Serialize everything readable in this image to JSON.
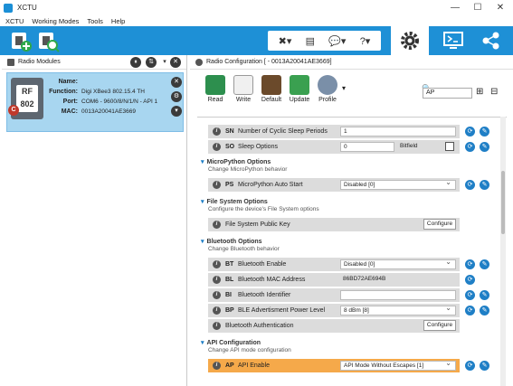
{
  "window": {
    "title": "XCTU",
    "minimize": "—",
    "maximize": "☐",
    "close": "✕"
  },
  "menu": [
    "XCTU",
    "Working Modes",
    "Tools",
    "Help"
  ],
  "toolbar": {
    "mid_icons": [
      "✖▾",
      "▤",
      "💬▾",
      "?▾"
    ],
    "gear_icon": "gear-icon",
    "right_icons": [
      "console-icon",
      "network-icon"
    ]
  },
  "left_pane": {
    "title": "Radio Modules",
    "radio": {
      "chip_text": "RF\n802",
      "badge": "C",
      "fields": [
        {
          "k": "Name:",
          "v": ""
        },
        {
          "k": "Function:",
          "v": "Digi XBee3 802.15.4 TH"
        },
        {
          "k": "Port:",
          "v": "COM6 - 9600/8/N/1/N - API 1"
        },
        {
          "k": "MAC:",
          "v": "0013A20041AE3669"
        }
      ]
    }
  },
  "right_pane": {
    "title": "Radio Configuration [ - 0013A20041AE3669]",
    "ribbon": [
      "Read",
      "Write",
      "Default",
      "Update",
      "Profile"
    ],
    "search": "AP",
    "rows": [
      {
        "code": "SN",
        "name": "Number of Cyclic Sleep Periods",
        "value": "1",
        "type": "text"
      },
      {
        "code": "SO",
        "name": "Sleep Options",
        "value": "0",
        "type": "bitfield",
        "extra": "Bitfield"
      },
      {
        "section": "MicroPython Options",
        "desc": "Change MicroPython behavior"
      },
      {
        "code": "PS",
        "name": "MicroPython Auto Start",
        "value": "Disabled [0]",
        "type": "select"
      },
      {
        "section": "File System Options",
        "desc": "Configure the device's File System options"
      },
      {
        "code": "",
        "name": "File System Public Key",
        "value": "Configure",
        "type": "button"
      },
      {
        "section": "Bluetooth Options",
        "desc": "Change Bluetooth behavior"
      },
      {
        "code": "BT",
        "name": "Bluetooth Enable",
        "value": "Disabled [0]",
        "type": "select"
      },
      {
        "code": "BL",
        "name": "Bluetooth MAC Address",
        "value": "86BD72AE694B",
        "type": "plain"
      },
      {
        "code": "BI",
        "name": "Bluetooth Identifier",
        "value": "",
        "type": "text"
      },
      {
        "code": "BP",
        "name": "BLE Advertisment Power Level",
        "value": "8 dBm [8]",
        "type": "select"
      },
      {
        "code": "",
        "name": "Bluetooth Authentication",
        "value": "Configure",
        "type": "button"
      },
      {
        "section": "API Configuration",
        "desc": "Change API mode configuration"
      },
      {
        "code": "AP",
        "name": "API Enable",
        "value": "API Mode Without Escapes [1]",
        "type": "select",
        "highlight": true
      }
    ]
  }
}
